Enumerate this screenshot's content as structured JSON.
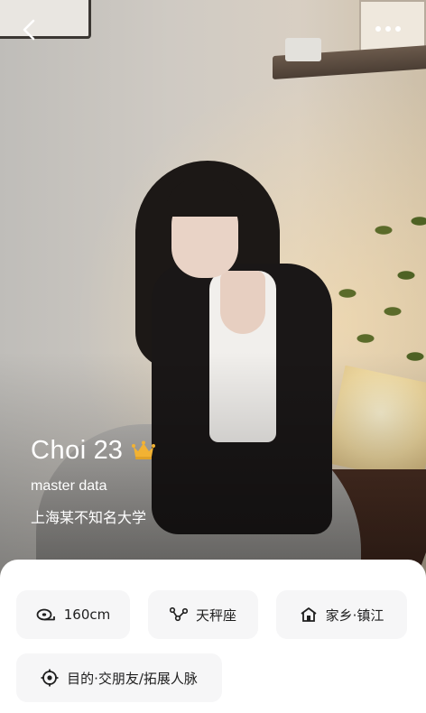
{
  "profile": {
    "name": "Choi",
    "age": "23",
    "major": "master data",
    "school": "上海某不知名大学"
  },
  "tags": {
    "height": "160cm",
    "zodiac": "天秤座",
    "hometown": "家乡·镇江",
    "purpose": "目的·交朋友/拓展人脉"
  },
  "icons": {
    "back": "chevron-left-icon",
    "more": "more-dots-icon",
    "vip": "crown-icon",
    "height": "tape-measure-icon",
    "zodiac": "constellation-icon",
    "hometown": "house-icon",
    "purpose": "target-icon"
  },
  "colors": {
    "crown": "#f2b233",
    "chip_bg": "#f6f6f7",
    "chip_text": "#1f1f1f"
  }
}
